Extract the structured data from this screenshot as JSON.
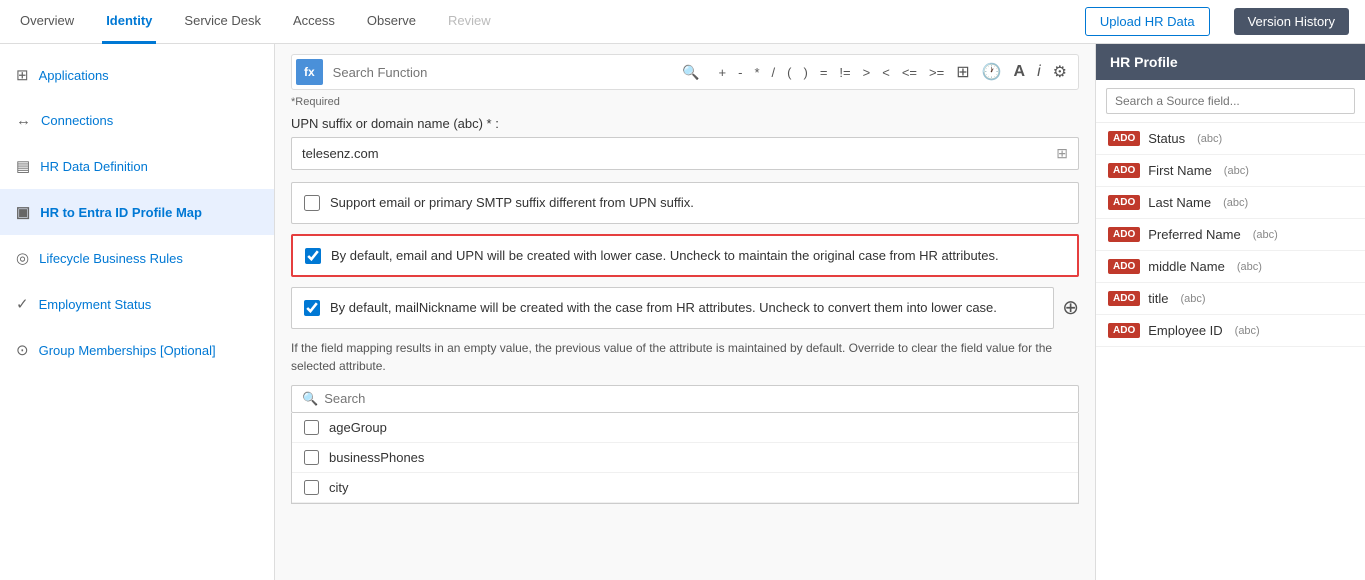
{
  "topNav": {
    "items": [
      {
        "label": "Overview",
        "active": false,
        "disabled": false
      },
      {
        "label": "Identity",
        "active": true,
        "disabled": false
      },
      {
        "label": "Service Desk",
        "active": false,
        "disabled": false
      },
      {
        "label": "Access",
        "active": false,
        "disabled": false
      },
      {
        "label": "Observe",
        "active": false,
        "disabled": false
      },
      {
        "label": "Review",
        "active": false,
        "disabled": true
      }
    ],
    "uploadLabel": "Upload HR Data",
    "versionLabel": "Version History"
  },
  "sidebar": {
    "items": [
      {
        "label": "Applications",
        "icon": "⊞",
        "active": false
      },
      {
        "label": "Connections",
        "icon": "⇌",
        "active": false
      },
      {
        "label": "HR Data Definition",
        "icon": "⊟",
        "active": false
      },
      {
        "label": "HR to Entra ID Profile Map",
        "icon": "⊠",
        "active": true
      },
      {
        "label": "Lifecycle Business Rules",
        "icon": "◎",
        "active": false
      },
      {
        "label": "Employment Status",
        "icon": "✓",
        "active": false
      },
      {
        "label": "Group Memberships [Optional]",
        "icon": "⊙",
        "active": false
      }
    ]
  },
  "formulaBar": {
    "fxLabel": "fx",
    "searchPlaceholder": "Search Function",
    "operators": [
      "+",
      "-",
      "*",
      "/",
      "(",
      ")",
      "=",
      "!=",
      ">",
      "<",
      "<=",
      ">="
    ]
  },
  "content": {
    "requiredLabel": "*Required",
    "upnLabel": "UPN suffix or domain name (abc) *  :",
    "upnValue": "telesenz.com",
    "checkboxes": [
      {
        "id": "smtp-check",
        "checked": false,
        "label": "Support email or primary SMTP suffix different from UPN suffix.",
        "highlighted": false
      },
      {
        "id": "lowercase-check",
        "checked": true,
        "label": "By default, email and UPN will be created with lower case. Uncheck to maintain the original case from HR attributes.",
        "highlighted": true
      },
      {
        "id": "mailnickname-check",
        "checked": true,
        "label": "By default, mailNickname will be created with the case from HR attributes. Uncheck to convert them into lower case.",
        "highlighted": false
      }
    ],
    "infoText": "If the field mapping results in an empty value, the previous value of the attribute is maintained by default. Override to clear the field value for the selected attribute.",
    "searchPlaceholder": "Search",
    "dropdownItems": [
      {
        "label": "ageGroup",
        "checked": false
      },
      {
        "label": "businessPhones",
        "checked": false
      },
      {
        "label": "city",
        "checked": false
      }
    ]
  },
  "hrPanel": {
    "title": "HR Profile",
    "searchPlaceholder": "Search a Source field...",
    "fields": [
      {
        "name": "Status",
        "type": "(abc)"
      },
      {
        "name": "First Name",
        "type": "(abc)"
      },
      {
        "name": "Last Name",
        "type": "(abc)"
      },
      {
        "name": "Preferred Name",
        "type": "(abc)"
      },
      {
        "name": "middle Name",
        "type": "(abc)"
      },
      {
        "name": "title",
        "type": "(abc)"
      },
      {
        "name": "Employee ID",
        "type": "(abc)"
      }
    ]
  }
}
